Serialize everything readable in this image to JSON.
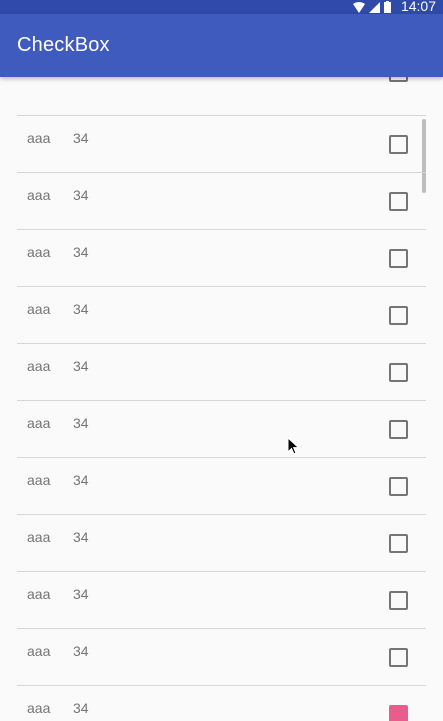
{
  "status_bar": {
    "time": "14:07",
    "icons": [
      "wifi-icon",
      "signal-icon",
      "battery-icon"
    ]
  },
  "app_bar": {
    "title": "CheckBox"
  },
  "list": {
    "partial_top_checked": false,
    "items": [
      {
        "name": "aaa",
        "count": "34",
        "checked": false
      },
      {
        "name": "aaa",
        "count": "34",
        "checked": false
      },
      {
        "name": "aaa",
        "count": "34",
        "checked": false
      },
      {
        "name": "aaa",
        "count": "34",
        "checked": false
      },
      {
        "name": "aaa",
        "count": "34",
        "checked": false
      },
      {
        "name": "aaa",
        "count": "34",
        "checked": false
      },
      {
        "name": "aaa",
        "count": "34",
        "checked": false
      },
      {
        "name": "aaa",
        "count": "34",
        "checked": false
      },
      {
        "name": "aaa",
        "count": "34",
        "checked": false
      },
      {
        "name": "aaa",
        "count": "34",
        "checked": false
      },
      {
        "name": "aaa",
        "count": "34",
        "checked": true
      }
    ]
  },
  "colors": {
    "status_bar": "#2f4aa8",
    "app_bar": "#3f5bbd",
    "background": "#fafafa",
    "checked_accent": "#e85d8c",
    "text": "#757575"
  }
}
